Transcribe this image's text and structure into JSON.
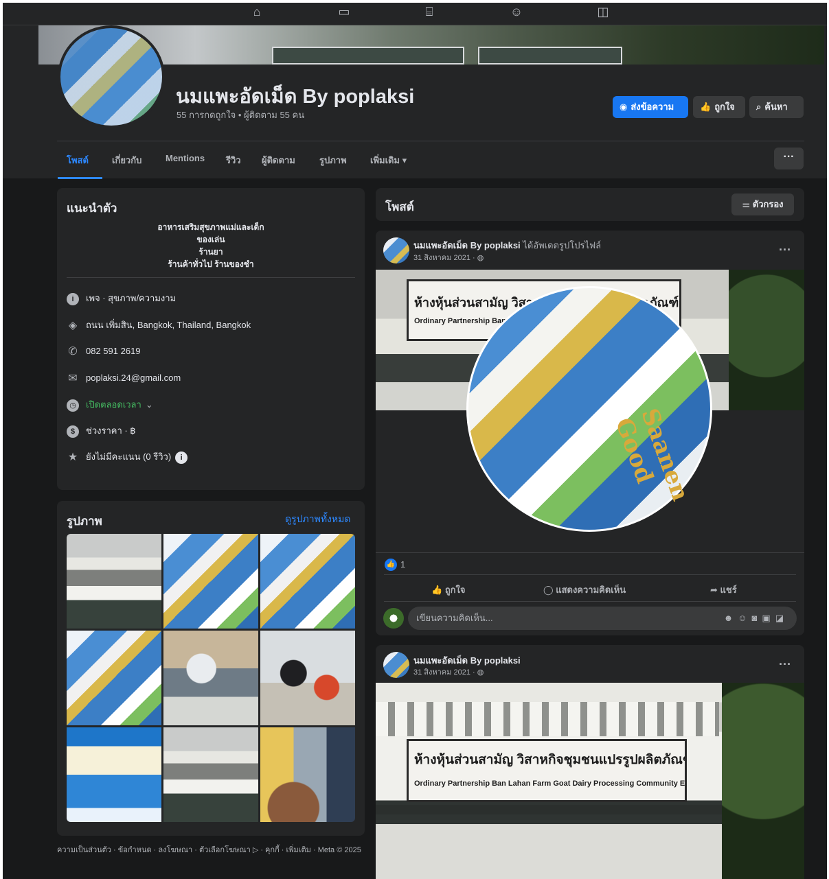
{
  "topnav": {
    "icons": [
      "home-icon",
      "video-icon",
      "marketplace-icon",
      "groups-icon",
      "gaming-icon"
    ]
  },
  "page": {
    "name": "นมแพะอัดเม็ด By poplaksi",
    "stats": "55 การกดถูกใจ • ผู้ติดตาม 55 คน",
    "buttons": {
      "message": "ส่งข้อความ",
      "like": "ถูกใจ",
      "search": "ค้นหา"
    }
  },
  "tabs": [
    "โพสต์",
    "เกี่ยวกับ",
    "Mentions",
    "รีวิว",
    "ผู้ติดตาม",
    "รูปภาพ",
    "เพิ่มเติม ▾"
  ],
  "more_label": "···",
  "intro": {
    "title": "แนะนำตัว",
    "bio": [
      "อาหารเสริมสุขภาพแม่และเด็ก",
      "ของเล่น",
      "ร้านยา",
      "ร้านค้าทั่วไป ร้านของชำ"
    ],
    "rows": {
      "category": "เพจ · สุขภาพ/ความงาม",
      "address": "ถนน เพิ่มสิน, Bangkok, Thailand, Bangkok",
      "phone": "082 591 2619",
      "email": "poplaksi.24@gmail.com",
      "hours": "เปิดตลอดเวลา",
      "price": "ช่วงราคา · ฿",
      "rating": "ยังไม่มีคะแนน (0 รีวิว)"
    }
  },
  "photos": {
    "title": "รูปภาพ",
    "see_all": "ดูรูปภาพทั้งหมด"
  },
  "footer": "ความเป็นส่วนตัว · ข้อกำหนด · ลงโฆษณา · ตัวเลือกโฆษณา ▷ · คุกกี้ · เพิ่มเติม · Meta © 2025",
  "posts_section": {
    "title": "โพสต์",
    "filter_label": "ตัวกรอง"
  },
  "post1": {
    "author": "นมแพะอัดเม็ด By poplaksi",
    "action": "ได้อัพเดตรูปโปรไฟล์",
    "date": "31 สิงหาคม 2021 · ",
    "privacy_icon": "globe-icon",
    "sign_text": "ห้างหุ้นส่วนสามัญ วิสาหกิจชุมชนแปรรูปผลิตภัณฑ์นมแพะบ้านละหารฟาร์ม",
    "sign_text_en": "Ordinary Partnership Ban",
    "product_text": "Saanen Good",
    "like_count": "1",
    "actions": {
      "like": "ถูกใจ",
      "comment": "แสดงความคิดเห็น",
      "share": "แชร์"
    },
    "comment_placeholder": "เขียนความคิดเห็น..."
  },
  "post2": {
    "author": "นมแพะอัดเม็ด By poplaksi",
    "date": "31 สิงหาคม 2021 · ",
    "sign_line1": "ห้างหุ้นส่วนสามัญ วิสาหกิจชุมชนแปรรูปผลิตภัณฑ์นมแพะบ้านละหารฟาร์ม",
    "sign_line2": "Ordinary Partnership Ban Lahan Farm Goat Dairy Processing Community Enterprise"
  },
  "colors": {
    "accent": "#1877f2",
    "link": "#2d88ff",
    "background": "#18191a",
    "card": "#242526",
    "open_status": "#45bd62"
  }
}
